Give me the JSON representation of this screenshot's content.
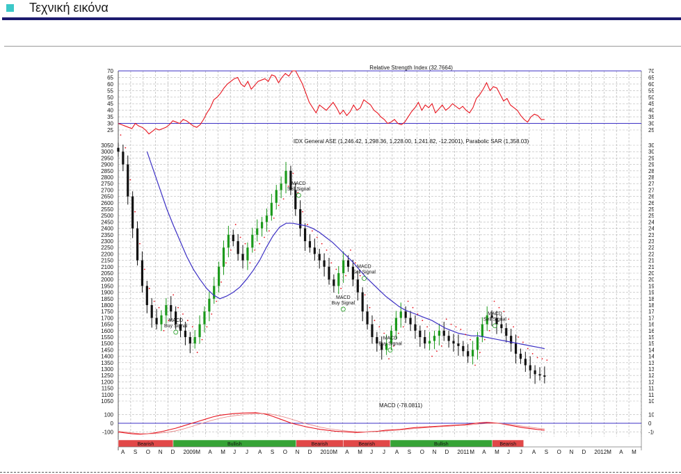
{
  "header": {
    "title": "Τεχνική εικόνα"
  },
  "colors": {
    "rsi_line": "#e8141e",
    "band_lines": "#3b2fc4",
    "ma_line": "#3b2fc4",
    "sar_dots": "#e8141e",
    "bull_candle": "#1c9a1c",
    "bear_candle": "#111111",
    "bearish_band": "#e14848",
    "bullish_band": "#36a336"
  },
  "chart_data": [
    {
      "type": "line",
      "title": "Relative Strength Index (32.7664)",
      "ylim": [
        25,
        70
      ],
      "y_ticks": [
        70,
        65,
        60,
        55,
        50,
        45,
        40,
        35,
        30,
        25
      ],
      "reference_lines": [
        70,
        30
      ],
      "series": [
        {
          "values": [
            30,
            29,
            28,
            27,
            26,
            30,
            28,
            27,
            25,
            22,
            24,
            26,
            25,
            26,
            27,
            29,
            32,
            31,
            30,
            33,
            32,
            30,
            28,
            27,
            29,
            33,
            38,
            42,
            48,
            50,
            53,
            57,
            60,
            62,
            64,
            65,
            60,
            58,
            62,
            56,
            59,
            62,
            63,
            64,
            62,
            67,
            66,
            61,
            65,
            68,
            66,
            70,
            70,
            65,
            60,
            53,
            46,
            42,
            38,
            44,
            42,
            40,
            43,
            46,
            42,
            37,
            40,
            36,
            39,
            44,
            40,
            42,
            48,
            46,
            44,
            40,
            38,
            35,
            33,
            30,
            31,
            33,
            30,
            29,
            31,
            35,
            39,
            42,
            46,
            40,
            44,
            42,
            45,
            38,
            41,
            44,
            40,
            42,
            45,
            43,
            41,
            43,
            40,
            38,
            42,
            49,
            52,
            56,
            61,
            55,
            58,
            57,
            52,
            47,
            49,
            44,
            42,
            40,
            36,
            33,
            31,
            35,
            37,
            36,
            33,
            33
          ]
        }
      ]
    },
    {
      "type": "line",
      "title": "IDX General ASE (1,246.42, 1,298.36, 1,228.00, 1,241.82, -12.2001), Parabolic SAR (1,358.03)",
      "ylim": [
        1050,
        3050
      ],
      "y_ticks": [
        3050,
        3000,
        2950,
        2900,
        2850,
        2800,
        2750,
        2700,
        2650,
        2600,
        2550,
        2500,
        2450,
        2400,
        2350,
        2300,
        2250,
        2200,
        2150,
        2100,
        2050,
        2000,
        1950,
        1900,
        1850,
        1800,
        1750,
        1700,
        1650,
        1600,
        1550,
        1500,
        1450,
        1400,
        1350,
        1300,
        1250,
        1200,
        1150,
        1100,
        1050
      ],
      "series": [
        {
          "values": [
            3000,
            2900,
            2650,
            2400,
            2150,
            1950,
            1800,
            1700,
            1650,
            1720,
            1800,
            1750,
            1650,
            1600,
            1550,
            1500,
            1550,
            1650,
            1750,
            1850,
            1950,
            2100,
            2250,
            2350,
            2300,
            2200,
            2150,
            2250,
            2350,
            2400,
            2450,
            2500,
            2600,
            2700,
            2750,
            2850,
            2700,
            2550,
            2400,
            2300,
            2250,
            2200,
            2150,
            2100,
            2000,
            1950,
            2050,
            2150,
            2100,
            2000,
            1900,
            1750,
            1650,
            1550,
            1500,
            1450,
            1500,
            1600,
            1700,
            1750,
            1700,
            1650,
            1600,
            1550,
            1500,
            1520,
            1560,
            1600,
            1560,
            1520,
            1500,
            1480,
            1440,
            1400,
            1450,
            1550,
            1650,
            1720,
            1700,
            1650,
            1620,
            1560,
            1500,
            1420,
            1380,
            1330,
            1290,
            1260,
            1250,
            1240
          ]
        },
        {
          "values": [
            3000,
            2850,
            2700,
            2550,
            2420,
            2300,
            2180,
            2080,
            2000,
            1930,
            1880,
            1850,
            1870,
            1900,
            1940,
            2000,
            2070,
            2150,
            2250,
            2340,
            2410,
            2440,
            2440,
            2430,
            2420,
            2400,
            2370,
            2330,
            2290,
            2240,
            2190,
            2140,
            2080,
            2020,
            1970,
            1920,
            1870,
            1830,
            1790,
            1760,
            1740,
            1720,
            1700,
            1680,
            1650,
            1620,
            1600,
            1580,
            1570,
            1560,
            1560,
            1550,
            1540,
            1530,
            1520,
            1510,
            1500,
            1490,
            1480,
            1470,
            1460
          ]
        }
      ],
      "annotations": [
        {
          "line1": "MACD",
          "line2": "Buy Signal"
        },
        {
          "line1": "MACD",
          "line2": "Sell Signal"
        },
        {
          "line1": "MACD",
          "line2": "Sell Signal"
        },
        {
          "line1": "MACD",
          "line2": "Buy Signal"
        },
        {
          "line1": "MACD",
          "line2": "Buy Signal"
        },
        {
          "line1": "MACD",
          "line2": "Sell Signal"
        }
      ]
    },
    {
      "type": "line",
      "title": "MACD (-78.0811)",
      "ylim": [
        -150,
        150
      ],
      "y_ticks": [
        100,
        0,
        -100
      ],
      "series": [
        {
          "values": [
            -100,
            -110,
            -120,
            -125,
            -120,
            -110,
            -95,
            -75,
            -55,
            -30,
            -5,
            20,
            45,
            70,
            90,
            100,
            110,
            115,
            118,
            120,
            110,
            90,
            60,
            30,
            0,
            -20,
            -40,
            -55,
            -70,
            -80,
            -90,
            -95,
            -100,
            -105,
            -100,
            -95,
            -90,
            -80,
            -75,
            -70,
            -60,
            -50,
            -45,
            -40,
            -35,
            -30,
            -25,
            -20,
            -15,
            -5,
            5,
            10,
            5,
            -5,
            -20,
            -35,
            -50,
            -60,
            -70,
            -78
          ]
        },
        {
          "values": [
            -90,
            -100,
            -110,
            -118,
            -120,
            -118,
            -110,
            -100,
            -85,
            -65,
            -40,
            -15,
            10,
            35,
            55,
            72,
            85,
            95,
            103,
            110,
            112,
            105,
            90,
            70,
            45,
            20,
            -5,
            -25,
            -45,
            -60,
            -72,
            -82,
            -90,
            -96,
            -98,
            -97,
            -94,
            -88,
            -82,
            -76,
            -68,
            -60,
            -54,
            -48,
            -42,
            -37,
            -32,
            -27,
            -22,
            -15,
            -8,
            -2,
            0,
            -4,
            -12,
            -22,
            -34,
            -45,
            -55,
            -63
          ]
        }
      ]
    }
  ],
  "trend_bands": [
    {
      "label": "Bearish",
      "kind": "bearish"
    },
    {
      "label": "Bullish",
      "kind": "bullish"
    },
    {
      "label": "Bearish",
      "kind": "bearish"
    },
    {
      "label": "Bearish",
      "kind": "bearish"
    },
    {
      "label": "Bullish",
      "kind": "bullish"
    },
    {
      "label": "Bearish",
      "kind": "bearish"
    }
  ],
  "x_axis_labels": [
    "A",
    "S",
    "O",
    "N",
    "D",
    "2009",
    "M",
    "A",
    "M",
    "J",
    "J",
    "A",
    "S",
    "O",
    "N",
    "D",
    "2010",
    "M",
    "A",
    "M",
    "J",
    "J",
    "A",
    "S",
    "O",
    "N",
    "D",
    "2011",
    "M",
    "A",
    "M",
    "J",
    "J",
    "A",
    "S",
    "O",
    "N",
    "D",
    "2012",
    "M",
    "A",
    "M"
  ]
}
